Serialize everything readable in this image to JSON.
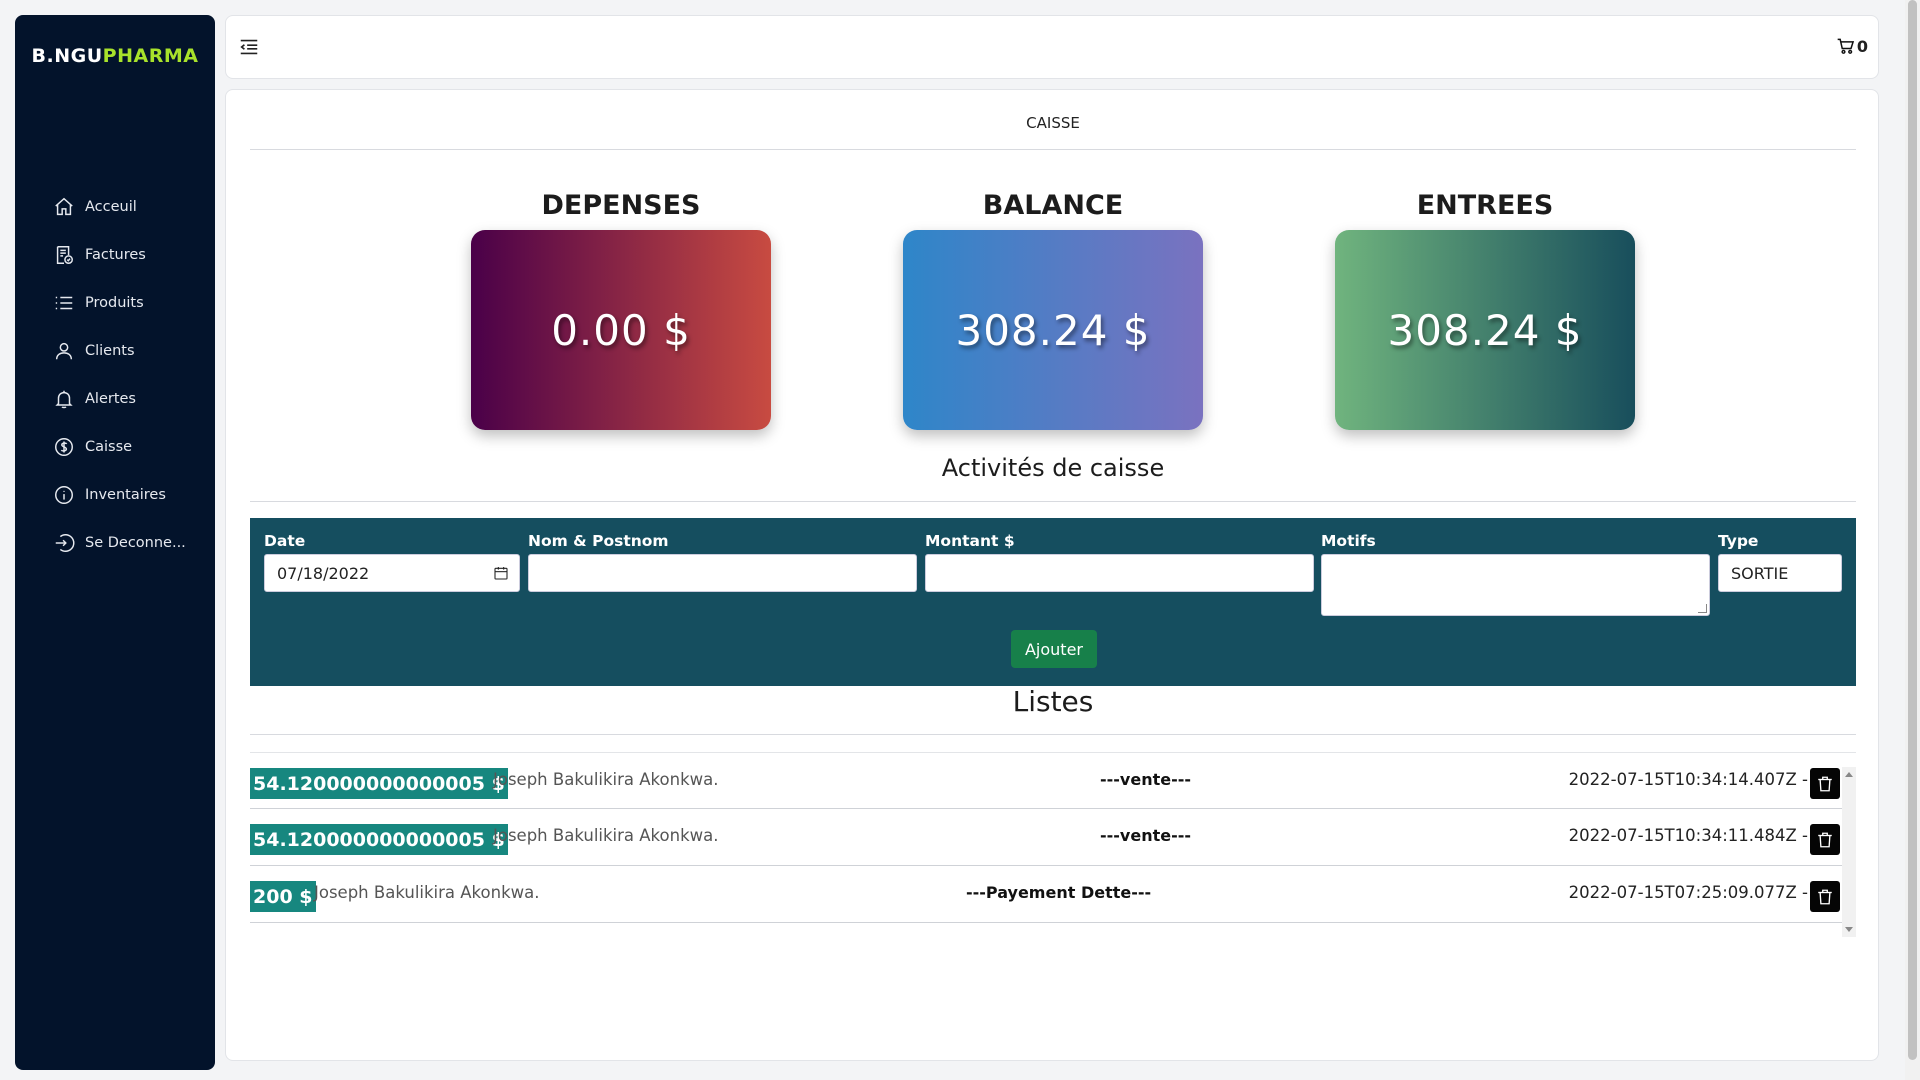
{
  "brand": {
    "part1": "B.NGU",
    "part2": "PHARMA"
  },
  "sidebar": {
    "items": [
      {
        "label": "Acceuil",
        "icon": "home-icon"
      },
      {
        "label": "Factures",
        "icon": "receipt-icon"
      },
      {
        "label": "Produits",
        "icon": "list-icon"
      },
      {
        "label": "Clients",
        "icon": "user-icon"
      },
      {
        "label": "Alertes",
        "icon": "bell-icon"
      },
      {
        "label": "Caisse",
        "icon": "dollar-circle-icon"
      },
      {
        "label": "Inventaires",
        "icon": "info-circle-icon"
      },
      {
        "label": "Se Deconne...",
        "icon": "logout-icon"
      }
    ]
  },
  "topbar": {
    "cart_count": "0"
  },
  "page": {
    "title": "CAISSE"
  },
  "stats": {
    "depenses": {
      "label": "DEPENSES",
      "value": "0.00 $"
    },
    "balance": {
      "label": "BALANCE",
      "value": "308.24 $"
    },
    "entrees": {
      "label": "ENTREES",
      "value": "308.24 $"
    }
  },
  "activities": {
    "title": "Activités de caisse"
  },
  "form": {
    "date_label": "Date",
    "date_value": "07/18/2022",
    "name_label": "Nom & Postnom",
    "name_value": "",
    "amount_label": "Montant $",
    "amount_value": "",
    "motif_label": "Motifs",
    "motif_value": "",
    "type_label": "Type",
    "type_value": "SORTIE",
    "submit_label": "Ajouter"
  },
  "list": {
    "title": "Listes",
    "rows": [
      {
        "amount": "54.120000000000005 $",
        "client": "Joseph Bakulikira Akonkwa.",
        "motif": "---vente---",
        "date": "2022-07-15T10:34:14.407Z -"
      },
      {
        "amount": "54.120000000000005 $",
        "client": "Joseph Bakulikira Akonkwa.",
        "motif": "---vente---",
        "date": "2022-07-15T10:34:11.484Z -"
      },
      {
        "amount": "200 $",
        "client": "Joseph Bakulikira Akonkwa.",
        "motif": "---Payement Dette---",
        "date": "2022-07-15T07:25:09.077Z -"
      }
    ]
  },
  "colors": {
    "sidebar_bg": "#03132b",
    "brand_accent": "#a8e22b",
    "form_panel": "#154e5f",
    "amount_badge": "#17877f",
    "submit_button": "#17804a"
  }
}
